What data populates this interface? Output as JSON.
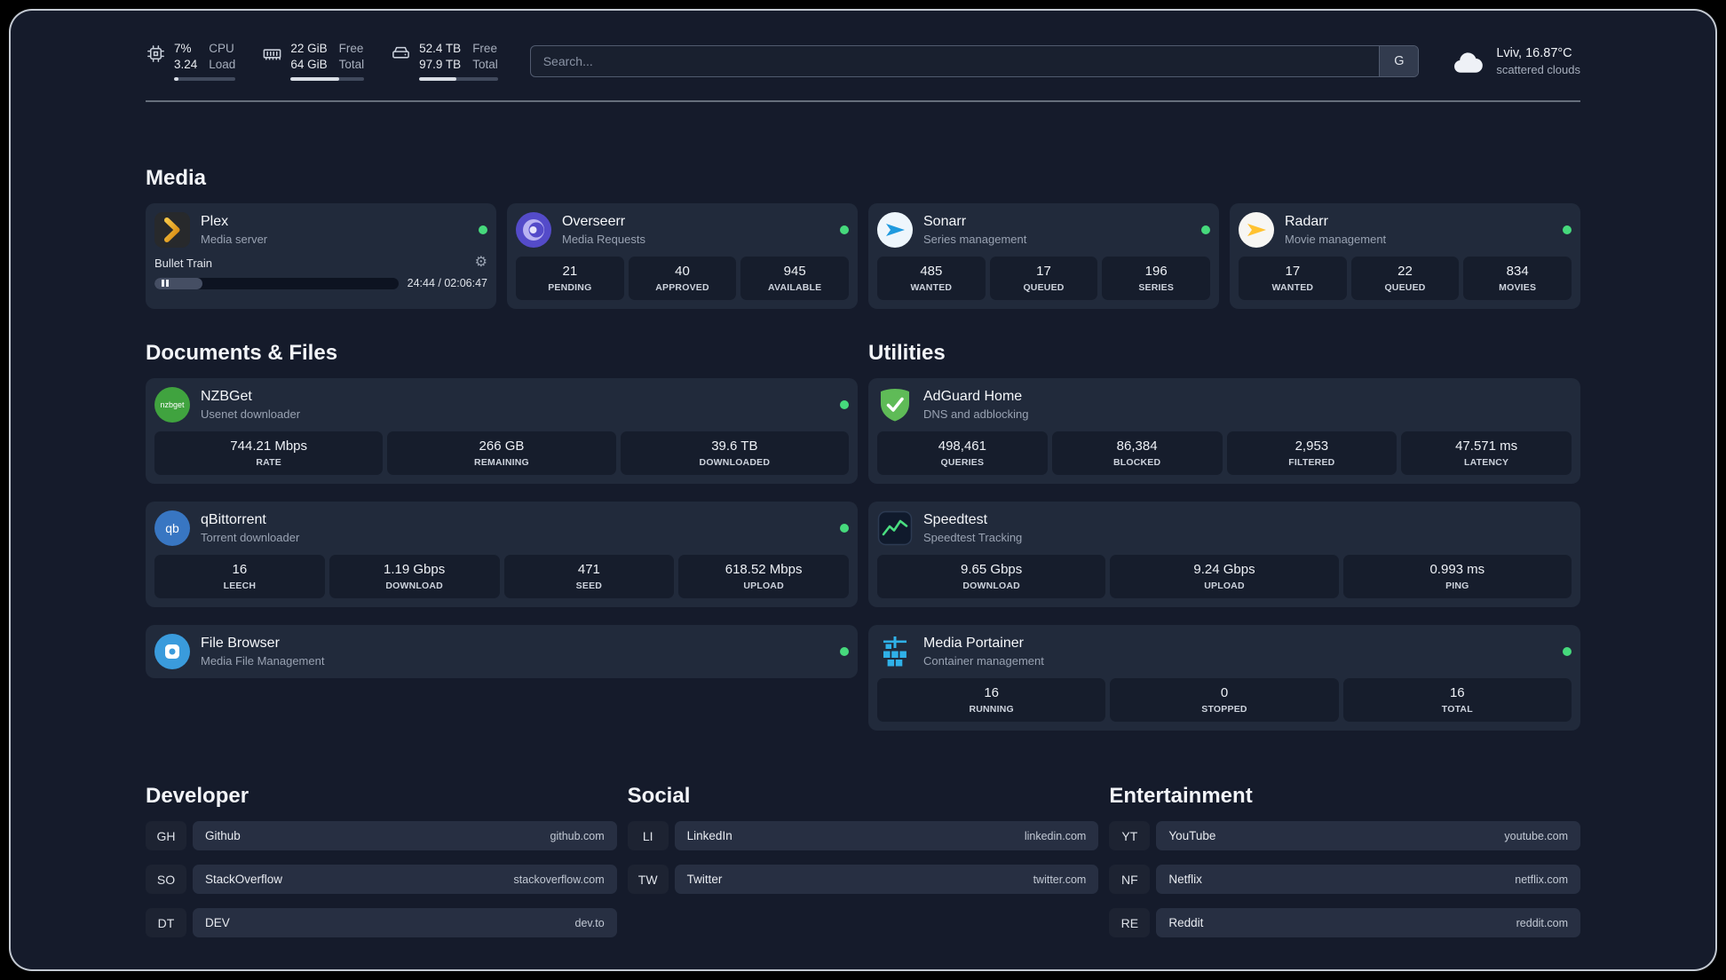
{
  "topbar": {
    "cpu": {
      "value_top": "7%",
      "value_bottom": "3.24",
      "label_top": "CPU",
      "label_bottom": "Load",
      "usage_pct": 7
    },
    "memory": {
      "value_top": "22 GiB",
      "value_bottom": "64 GiB",
      "label_top": "Free",
      "label_bottom": "Total",
      "usage_pct": 66
    },
    "disk": {
      "value_top": "52.4 TB",
      "value_bottom": "97.9 TB",
      "label_top": "Free",
      "label_bottom": "Total",
      "usage_pct": 47
    },
    "search": {
      "placeholder": "Search...",
      "button_label": "G"
    },
    "weather": {
      "location": "Lviv, 16.87°C",
      "condition": "scattered clouds"
    }
  },
  "media": {
    "title": "Media",
    "plex": {
      "name": "Plex",
      "desc": "Media server",
      "now_playing": {
        "title": "Bullet Train",
        "time": "24:44 / 02:06:47",
        "progress_pct": 19.5
      }
    },
    "overseerr": {
      "name": "Overseerr",
      "desc": "Media Requests",
      "stats": [
        {
          "value": "21",
          "label": "PENDING"
        },
        {
          "value": "40",
          "label": "APPROVED"
        },
        {
          "value": "945",
          "label": "AVAILABLE"
        }
      ]
    },
    "sonarr": {
      "name": "Sonarr",
      "desc": "Series management",
      "stats": [
        {
          "value": "485",
          "label": "WANTED"
        },
        {
          "value": "17",
          "label": "QUEUED"
        },
        {
          "value": "196",
          "label": "SERIES"
        }
      ]
    },
    "radarr": {
      "name": "Radarr",
      "desc": "Movie management",
      "stats": [
        {
          "value": "17",
          "label": "WANTED"
        },
        {
          "value": "22",
          "label": "QUEUED"
        },
        {
          "value": "834",
          "label": "MOVIES"
        }
      ]
    }
  },
  "documents": {
    "title": "Documents & Files",
    "nzbget": {
      "name": "NZBGet",
      "desc": "Usenet downloader",
      "stats": [
        {
          "value": "744.21 Mbps",
          "label": "RATE"
        },
        {
          "value": "266 GB",
          "label": "REMAINING"
        },
        {
          "value": "39.6 TB",
          "label": "DOWNLOADED"
        }
      ]
    },
    "qbittorrent": {
      "name": "qBittorrent",
      "desc": "Torrent downloader",
      "stats": [
        {
          "value": "16",
          "label": "LEECH"
        },
        {
          "value": "1.19 Gbps",
          "label": "DOWNLOAD"
        },
        {
          "value": "471",
          "label": "SEED"
        },
        {
          "value": "618.52 Mbps",
          "label": "UPLOAD"
        }
      ]
    },
    "filebrowser": {
      "name": "File Browser",
      "desc": "Media File Management"
    }
  },
  "utilities": {
    "title": "Utilities",
    "adguard": {
      "name": "AdGuard Home",
      "desc": "DNS and adblocking",
      "stats": [
        {
          "value": "498,461",
          "label": "QUERIES"
        },
        {
          "value": "86,384",
          "label": "BLOCKED"
        },
        {
          "value": "2,953",
          "label": "FILTERED"
        },
        {
          "value": "47.571 ms",
          "label": "LATENCY"
        }
      ]
    },
    "speedtest": {
      "name": "Speedtest",
      "desc": "Speedtest Tracking",
      "stats": [
        {
          "value": "9.65 Gbps",
          "label": "DOWNLOAD"
        },
        {
          "value": "9.24 Gbps",
          "label": "UPLOAD"
        },
        {
          "value": "0.993 ms",
          "label": "PING"
        }
      ]
    },
    "portainer": {
      "name": "Media Portainer",
      "desc": "Container management",
      "stats": [
        {
          "value": "16",
          "label": "RUNNING"
        },
        {
          "value": "0",
          "label": "STOPPED"
        },
        {
          "value": "16",
          "label": "TOTAL"
        }
      ]
    }
  },
  "bookmarks": {
    "developer": {
      "title": "Developer",
      "items": [
        {
          "abbr": "GH",
          "name": "Github",
          "domain": "github.com"
        },
        {
          "abbr": "SO",
          "name": "StackOverflow",
          "domain": "stackoverflow.com"
        },
        {
          "abbr": "DT",
          "name": "DEV",
          "domain": "dev.to"
        }
      ]
    },
    "social": {
      "title": "Social",
      "items": [
        {
          "abbr": "LI",
          "name": "LinkedIn",
          "domain": "linkedin.com"
        },
        {
          "abbr": "TW",
          "name": "Twitter",
          "domain": "twitter.com"
        }
      ]
    },
    "entertainment": {
      "title": "Entertainment",
      "items": [
        {
          "abbr": "YT",
          "name": "YouTube",
          "domain": "youtube.com"
        },
        {
          "abbr": "NF",
          "name": "Netflix",
          "domain": "netflix.com"
        },
        {
          "abbr": "RE",
          "name": "Reddit",
          "domain": "reddit.com"
        }
      ]
    }
  }
}
